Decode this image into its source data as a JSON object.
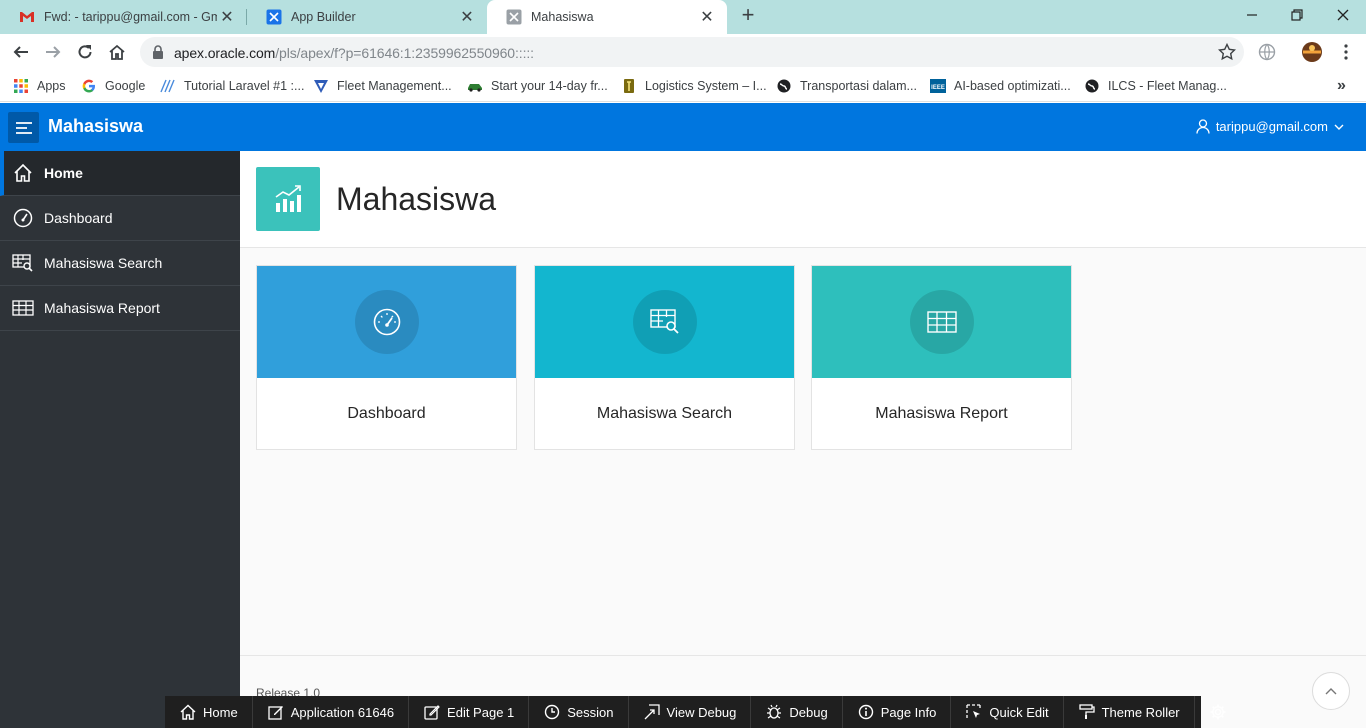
{
  "browser": {
    "tabs": [
      {
        "title": "Fwd: - tarippu@gmail.com - Gmail",
        "close": "✕"
      },
      {
        "title": "App Builder",
        "close": "✕"
      },
      {
        "title": "Mahasiswa",
        "close": "✕"
      }
    ],
    "new_tab": "+",
    "url_host": "apex.oracle.com",
    "url_path": "/pls/apex/f?p=61646:1:2359962550960:::::",
    "bookmarks": [
      {
        "label": "Apps",
        "icon": "apps-grid-icon"
      },
      {
        "label": "Google",
        "icon": "google-icon"
      },
      {
        "label": "Tutorial Laravel #1 :...",
        "icon": "laravel-icon"
      },
      {
        "label": "Fleet Management...",
        "icon": "fleet-icon"
      },
      {
        "label": "Start your 14-day fr...",
        "icon": "car-icon"
      },
      {
        "label": "Logistics System – I...",
        "icon": "logistics-icon"
      },
      {
        "label": "Transportasi dalam...",
        "icon": "globe-icon"
      },
      {
        "label": "AI-based optimizati...",
        "icon": "ieee-icon"
      },
      {
        "label": "ILCS - Fleet Manag...",
        "icon": "globe-icon"
      }
    ],
    "bookmarks_more": "»",
    "ieee": "IEEE"
  },
  "app": {
    "name": "Mahasiswa",
    "user": "tarippu@gmail.com",
    "brand_color": "#0076df"
  },
  "nav": {
    "items": [
      {
        "label": "Home",
        "icon": "home-icon"
      },
      {
        "label": "Dashboard",
        "icon": "gauge-icon"
      },
      {
        "label": "Mahasiswa Search",
        "icon": "table-search-icon"
      },
      {
        "label": "Mahasiswa Report",
        "icon": "table-icon"
      }
    ]
  },
  "page": {
    "title": "Mahasiswa",
    "cards": [
      {
        "label": "Dashboard",
        "color": "#309fdb",
        "icon": "gauge-icon"
      },
      {
        "label": "Mahasiswa Search",
        "color": "#13b6cf",
        "icon": "table-search-icon"
      },
      {
        "label": "Mahasiswa Report",
        "color": "#2ebfbc",
        "icon": "table-icon"
      }
    ],
    "release": "Release 1.0"
  },
  "devbar": {
    "items": [
      {
        "label": "Home",
        "icon": "home-icon"
      },
      {
        "label": "Application 61646",
        "icon": "edit-app-icon"
      },
      {
        "label": "Edit Page 1",
        "icon": "edit-page-icon"
      },
      {
        "label": "Session",
        "icon": "clock-icon"
      },
      {
        "label": "View Debug",
        "icon": "view-debug-icon"
      },
      {
        "label": "Debug",
        "icon": "bug-icon"
      },
      {
        "label": "Page Info",
        "icon": "info-icon"
      },
      {
        "label": "Quick Edit",
        "icon": "quick-edit-icon"
      },
      {
        "label": "Theme Roller",
        "icon": "paint-roller-icon"
      }
    ],
    "settings_icon": "gear-icon"
  }
}
